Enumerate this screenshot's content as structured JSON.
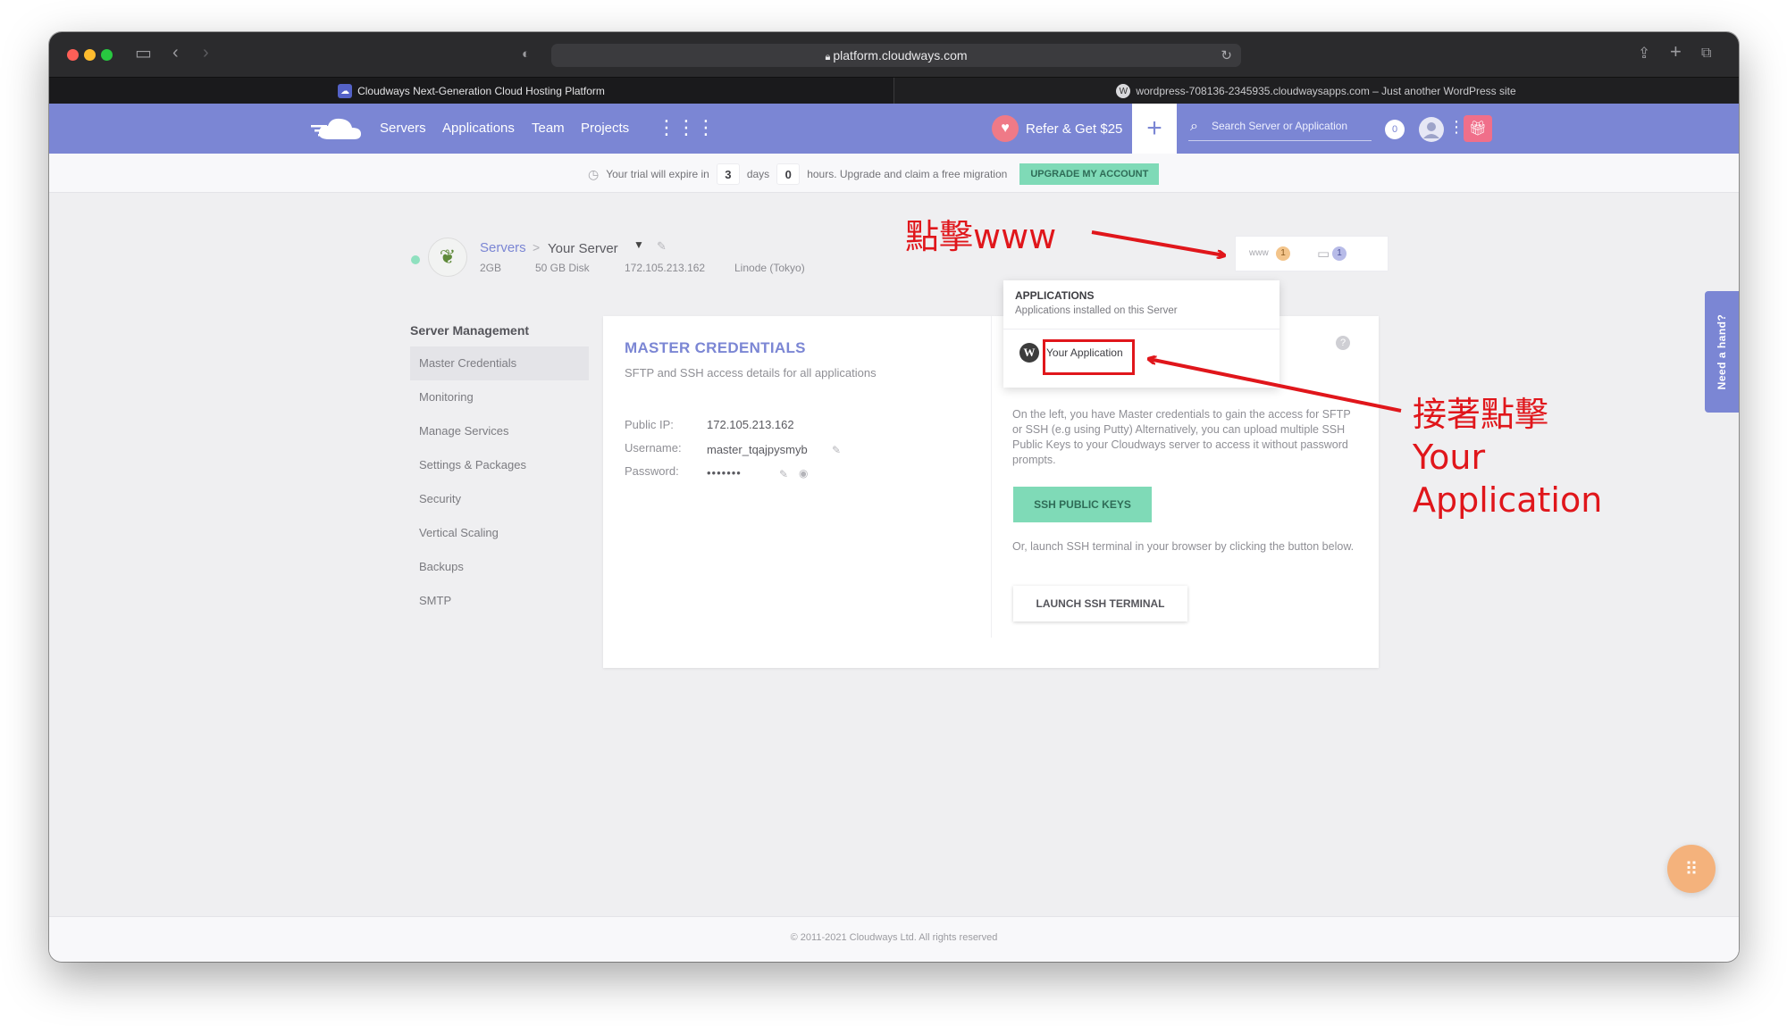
{
  "browser": {
    "url": "platform.cloudways.com",
    "tabs": [
      {
        "label": "Cloudways Next-Generation Cloud Hosting Platform",
        "active": true
      },
      {
        "label": "wordpress-708136-2345935.cloudwaysapps.com – Just another WordPress site",
        "active": false
      }
    ]
  },
  "nav": {
    "links": [
      "Servers",
      "Applications",
      "Team",
      "Projects"
    ],
    "refer_label": "Refer & Get $25",
    "search_placeholder": "Search Server or Application",
    "notification_count": "0"
  },
  "trial": {
    "prefix": "Your trial will expire in",
    "days": "3",
    "days_label": "days",
    "hours": "0",
    "suffix": "hours. Upgrade and claim a free migration",
    "button": "UPGRADE MY ACCOUNT"
  },
  "server": {
    "breadcrumb_root": "Servers",
    "breadcrumb_sep": ">",
    "name": "Your Server",
    "size": "2GB",
    "disk": "50 GB Disk",
    "ip": "172.105.213.162",
    "location": "Linode (Tokyo)",
    "www_label": "www",
    "www_count": "1",
    "files_count": "1"
  },
  "sidebar": {
    "title": "Server Management",
    "items": [
      "Master Credentials",
      "Monitoring",
      "Manage Services",
      "Settings & Packages",
      "Security",
      "Vertical Scaling",
      "Backups",
      "SMTP"
    ],
    "active_index": 0
  },
  "credentials": {
    "title": "MASTER CREDENTIALS",
    "subtitle": "SFTP and SSH access details for all applications",
    "public_ip_label": "Public IP:",
    "public_ip": "172.105.213.162",
    "username_label": "Username:",
    "username": "master_tqajpysmyb",
    "password_label": "Password:",
    "password": "•••••••",
    "description": "On the left, you have Master credentials to gain the access for SFTP or SSH (e.g using Putty) Alternatively, you can upload multiple SSH Public Keys to your Cloudways server to access it without password prompts.",
    "ssh_keys_button": "SSH PUBLIC KEYS",
    "terminal_description": "Or, launch SSH terminal in your browser by clicking the button below.",
    "terminal_button": "LAUNCH SSH TERMINAL"
  },
  "applications_dropdown": {
    "title": "APPLICATIONS",
    "subtitle": "Applications installed on this Server",
    "items": [
      "Your Application"
    ]
  },
  "help_tab": "Need a hand?",
  "footer": "© 2011-2021 Cloudways Ltd. All rights reserved",
  "annotations": {
    "step1": "點擊www",
    "step2": [
      "接著點擊",
      "Your",
      "Application"
    ]
  },
  "colors": {
    "brand": "#7b86d4",
    "accent_green": "#7fdab7",
    "annotation_red": "#e0161b"
  }
}
